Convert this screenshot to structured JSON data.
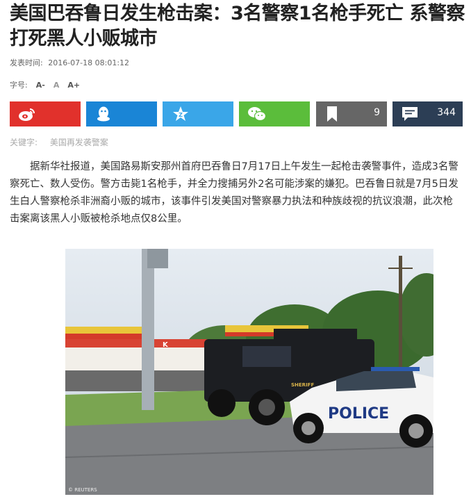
{
  "article": {
    "title": "美国巴吞鲁日发生枪击案：3名警察1名枪手死亡 系警察打死黑人小贩城市",
    "publish_label": "发表时间:",
    "publish_time": "2016-07-18 08:01:12",
    "font_size_label": "字号:",
    "font_size_options": [
      "A-",
      "A",
      "A+"
    ],
    "keywords_label": "关键字:",
    "keywords": [
      "美国再发袭警案"
    ],
    "body": "据新华社报道，美国路易斯安那州首府巴吞鲁日7月17日上午发生一起枪击袭警事件，造成3名警察死亡、数人受伤。警方击毙1名枪手，并全力搜捕另外2名可能涉案的嫌犯。巴吞鲁日就是7月5日发生白人警察枪杀非洲裔小贩的城市，该事件引发美国对警察暴力执法和种族歧视的抗议浪潮，此次枪击案离该黑人小贩被枪杀地点仅8公里。",
    "photo_credit": "© REUTERS",
    "photo_text": {
      "police": "POLICE",
      "sheriff": "SHERIFF",
      "store_letter": "K"
    }
  },
  "share": {
    "bookmark_count": "9",
    "comment_count": "344",
    "buttons": [
      {
        "name": "weibo",
        "icon": "weibo-icon",
        "color": "#e1312c"
      },
      {
        "name": "qq",
        "icon": "qq-icon",
        "color": "#1a85d6"
      },
      {
        "name": "qzone",
        "icon": "qzone-star-icon",
        "color": "#3aa6e8"
      },
      {
        "name": "wechat",
        "icon": "wechat-icon",
        "color": "#5bbd3b"
      },
      {
        "name": "bookmark",
        "icon": "bookmark-icon",
        "color": "#666666"
      },
      {
        "name": "comments",
        "icon": "comment-icon",
        "color": "#2c3e55"
      }
    ]
  }
}
